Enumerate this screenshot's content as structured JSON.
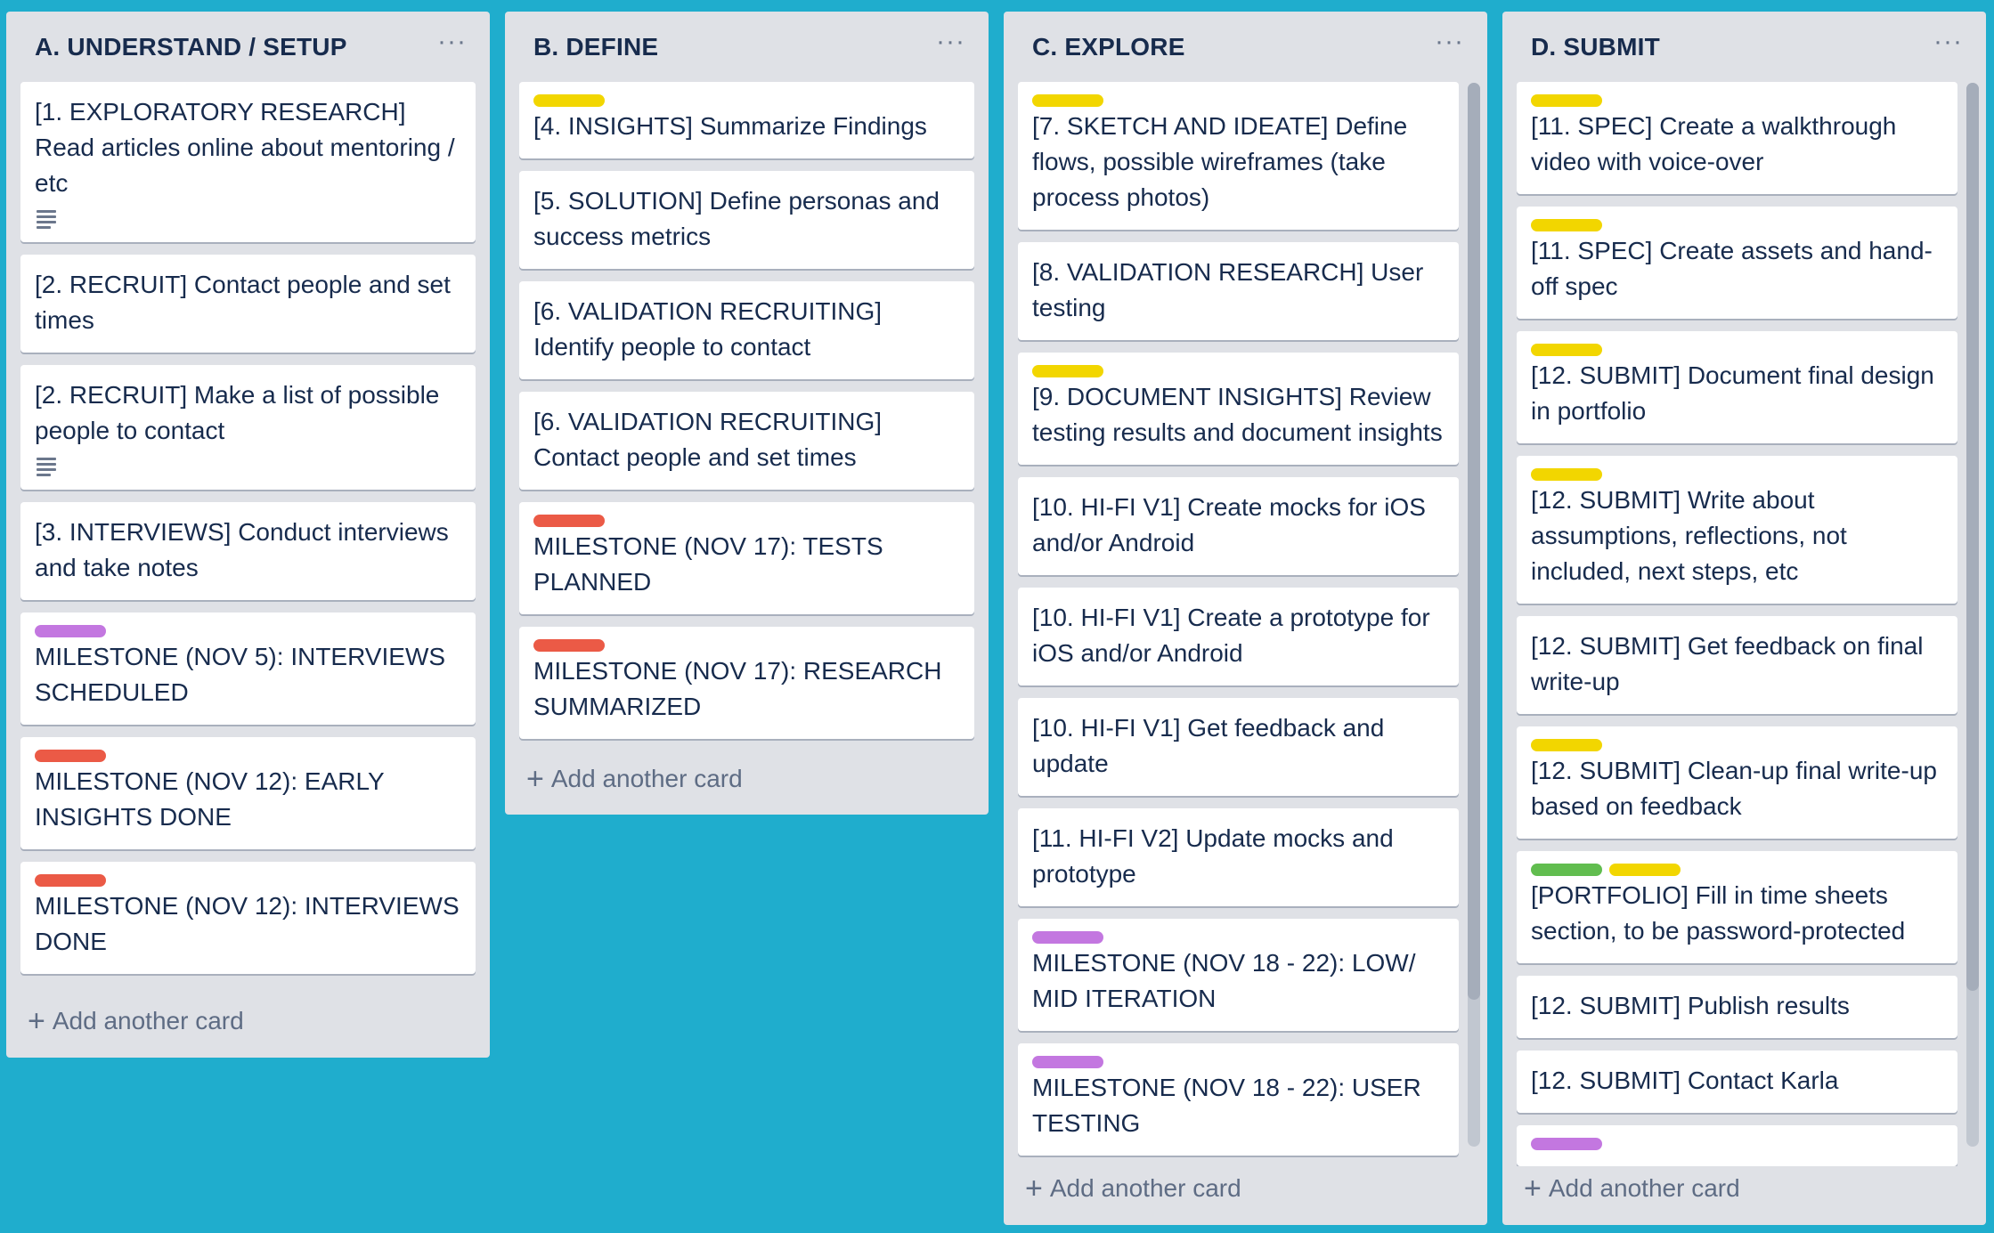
{
  "lists": {
    "a": {
      "title": "A. UNDERSTAND / SETUP",
      "menu": "···",
      "add_card": "Add another card",
      "cards": [
        {
          "text": "[1. EXPLORATORY RESEARCH] Read articles online about mentoring / etc"
        },
        {
          "text": "[2. RECRUIT] Contact people and set times"
        },
        {
          "text": "[2. RECRUIT] Make a list of possible people to contact"
        },
        {
          "text": "[3. INTERVIEWS] Conduct interviews and take notes"
        },
        {
          "text": "MILESTONE (NOV 5): INTERVIEWS SCHEDULED"
        },
        {
          "text": "MILESTONE (NOV 12): EARLY INSIGHTS DONE"
        },
        {
          "text": "MILESTONE (NOV 12): INTERVIEWS DONE"
        }
      ]
    },
    "b": {
      "title": "B. DEFINE",
      "menu": "···",
      "add_card": "Add another card",
      "cards": [
        {
          "text": "[4. INSIGHTS] Summarize Findings"
        },
        {
          "text": "[5. SOLUTION] Define personas and success metrics"
        },
        {
          "text": "[6. VALIDATION RECRUITING] Identify people to contact"
        },
        {
          "text": "[6. VALIDATION RECRUITING] Contact people and set times"
        },
        {
          "text": "MILESTONE (NOV 17): TESTS PLANNED"
        },
        {
          "text": "MILESTONE (NOV 17): RESEARCH SUMMARIZED"
        }
      ]
    },
    "c": {
      "title": "C. EXPLORE",
      "menu": "···",
      "add_card": "Add another card",
      "cards": [
        {
          "text": "[7. SKETCH AND IDEATE] Define flows, possible wireframes (take process photos)"
        },
        {
          "text": "[8. VALIDATION RESEARCH] User testing"
        },
        {
          "text": "[9. DOCUMENT INSIGHTS] Review testing results and document insights"
        },
        {
          "text": "[10. HI-FI V1] Create mocks for iOS and/or Android"
        },
        {
          "text": "[10. HI-FI V1] Create a prototype for iOS and/or Android"
        },
        {
          "text": "[10. HI-FI V1] Get feedback and update"
        },
        {
          "text": "[11. HI-FI V2] Update mocks and prototype"
        },
        {
          "text": "MILESTONE (NOV 18 - 22): LOW/ MID ITERATION"
        },
        {
          "text": "MILESTONE (NOV 18 - 22): USER TESTING"
        }
      ]
    },
    "d": {
      "title": "D. SUBMIT",
      "menu": "···",
      "add_card": "Add another card",
      "cards": [
        {
          "text": "[11. SPEC] Create a walkthrough video with voice-over"
        },
        {
          "text": "[11. SPEC] Create assets and hand-off spec"
        },
        {
          "text": "[12. SUBMIT] Document final design in portfolio"
        },
        {
          "text": "[12. SUBMIT] Write about assumptions, reflections, not included, next steps, etc"
        },
        {
          "text": "[12. SUBMIT] Get feedback on final write-up"
        },
        {
          "text": "[12. SUBMIT] Clean-up final write-up based on feedback"
        },
        {
          "text": "[PORTFOLIO] Fill in time sheets section, to be password-protected"
        },
        {
          "text": "[12. SUBMIT] Publish results"
        },
        {
          "text": "[12. SUBMIT] Contact Karla"
        },
        {
          "text": ""
        }
      ]
    }
  },
  "colors": {
    "board_bg": "#1fadcd",
    "label_yellow": "#f2d600",
    "label_red": "#eb5a46",
    "label_purple": "#c377e0",
    "label_green": "#61bd4f"
  }
}
